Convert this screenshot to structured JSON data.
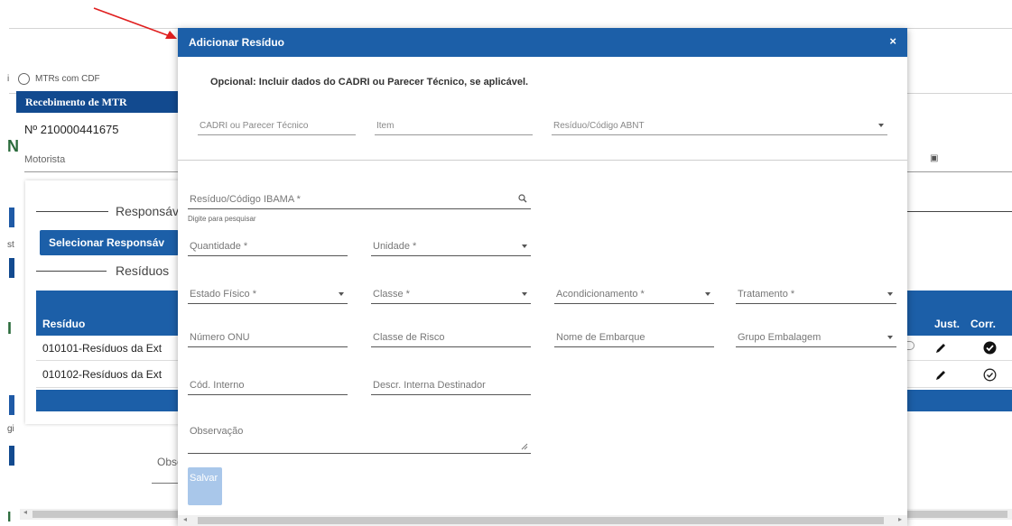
{
  "background": {
    "radio_label": "MTRs com CDF",
    "panel_title": "Recebimento de MTR",
    "mtr_number": "Nº 210000441675",
    "driver_label": "Motorista",
    "section_responsible": "Responsáv",
    "select_responsible_button": "Selecionar Responsáv",
    "section_residues": "Resíduos",
    "table": {
      "headers": {
        "residue": "Resíduo",
        "just": "Just.",
        "corr": "Corr."
      },
      "rows": [
        {
          "residue": "010101-Resíduos da Ext"
        },
        {
          "residue": "010102-Resíduos da Ext"
        }
      ]
    },
    "obs_fragment": "Obse",
    "left_fragments": {
      "a": "st",
      "b": "gi"
    }
  },
  "modal": {
    "title": "Adicionar Resíduo",
    "close_label": "×",
    "subtitle": "Opcional: Incluir dados do CADRI ou Parecer Técnico, se aplicável.",
    "fields": {
      "cadri": "CADRI ou Parecer Técnico",
      "item": "Item",
      "abnt": "Resíduo/Código ABNT",
      "ibama": "Resíduo/Código IBAMA *",
      "ibama_hint": "Digite para pesquisar",
      "quantidade": "Quantidade *",
      "unidade": "Unidade *",
      "estado_fisico": "Estado Físico *",
      "classe": "Classe *",
      "acondicionamento": "Acondicionamento *",
      "tratamento": "Tratamento *",
      "numero_onu": "Número ONU",
      "classe_risco": "Classe de Risco",
      "nome_embarque": "Nome de Embarque",
      "grupo_embalagem": "Grupo Embalagem",
      "cod_interno": "Cód. Interno",
      "descr_interna": "Descr. Interna Destinador",
      "observacao": "Observação"
    },
    "save_button": "Salvar"
  }
}
